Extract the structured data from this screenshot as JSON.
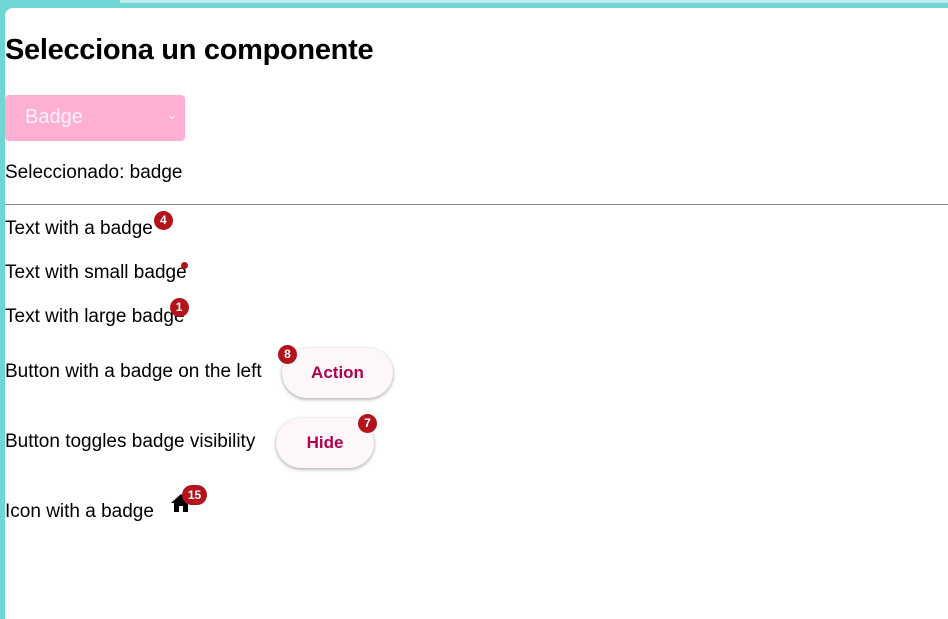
{
  "header": {
    "title": "Selecciona un componente"
  },
  "selector": {
    "selected_label": "Badge",
    "accent_color": "#ffafd3"
  },
  "selection_status": {
    "text": "Seleccionado: badge"
  },
  "demo": {
    "text_badge": {
      "label": "Text with a badge",
      "badge": "4"
    },
    "text_small_badge": {
      "label": "Text with small badge"
    },
    "text_large_badge": {
      "label": "Text with large badge",
      "badge": "1"
    },
    "button_left_badge": {
      "label": "Button with a badge on the left",
      "button_label": "Action",
      "badge": "8"
    },
    "button_toggle_badge": {
      "label": "Button toggles badge visibility",
      "button_label": "Hide",
      "badge": "7"
    },
    "icon_badge": {
      "label": "Icon with a badge",
      "icon": "home-icon",
      "badge": "15"
    }
  },
  "colors": {
    "badge": "#b3141b",
    "button_text": "#b0004e",
    "page_border": "#6fd6d4"
  }
}
